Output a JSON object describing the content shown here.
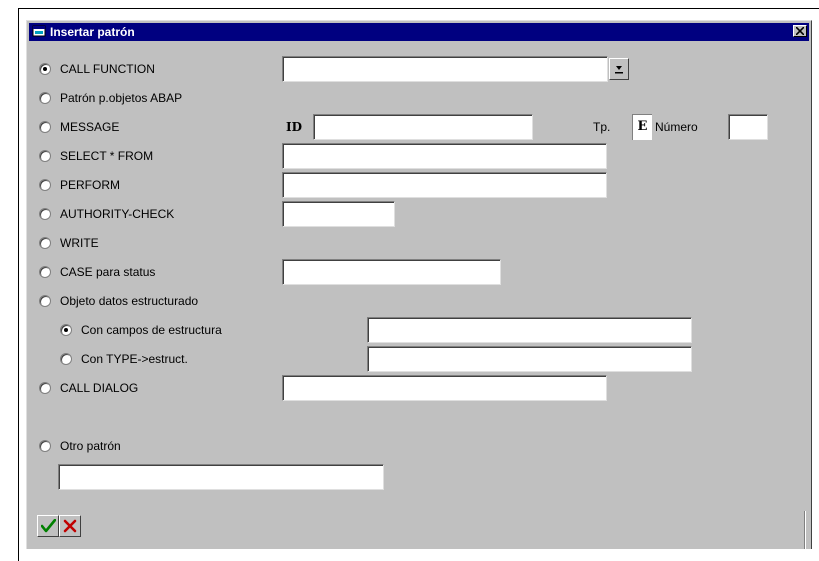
{
  "window": {
    "title": "Insertar patrón"
  },
  "options": [
    {
      "label": "CALL FUNCTION",
      "selected": true
    },
    {
      "label": "Patrón p.objetos ABAP",
      "selected": false
    },
    {
      "label": "MESSAGE",
      "selected": false
    },
    {
      "label": "SELECT * FROM",
      "selected": false
    },
    {
      "label": "PERFORM",
      "selected": false
    },
    {
      "label": "AUTHORITY-CHECK",
      "selected": false
    },
    {
      "label": "WRITE",
      "selected": false
    },
    {
      "label": "CASE para status",
      "selected": false
    },
    {
      "label": "Objeto datos estructurado",
      "selected": false
    },
    {
      "label": "Con campos de estructura",
      "selected": true
    },
    {
      "label": "Con TYPE->estruct.",
      "selected": false
    },
    {
      "label": "CALL DIALOG",
      "selected": false
    },
    {
      "label": "Otro patrón",
      "selected": false
    }
  ],
  "message": {
    "id_label": "ID",
    "tp_label": "Tp.",
    "tp_value": "E",
    "numero_label": "Número"
  },
  "fields": {
    "call_function": "",
    "message_id": "",
    "message_numero": "",
    "select_from": "",
    "perform": "",
    "authority_check": "",
    "case_status": "",
    "con_campos": "",
    "con_type": "",
    "call_dialog": "",
    "otro_patron": ""
  },
  "icons": {
    "dropdown": "dropdown-arrow-icon",
    "confirm": "checkmark-icon",
    "cancel": "cancel-x-icon",
    "window": "window-icon"
  }
}
